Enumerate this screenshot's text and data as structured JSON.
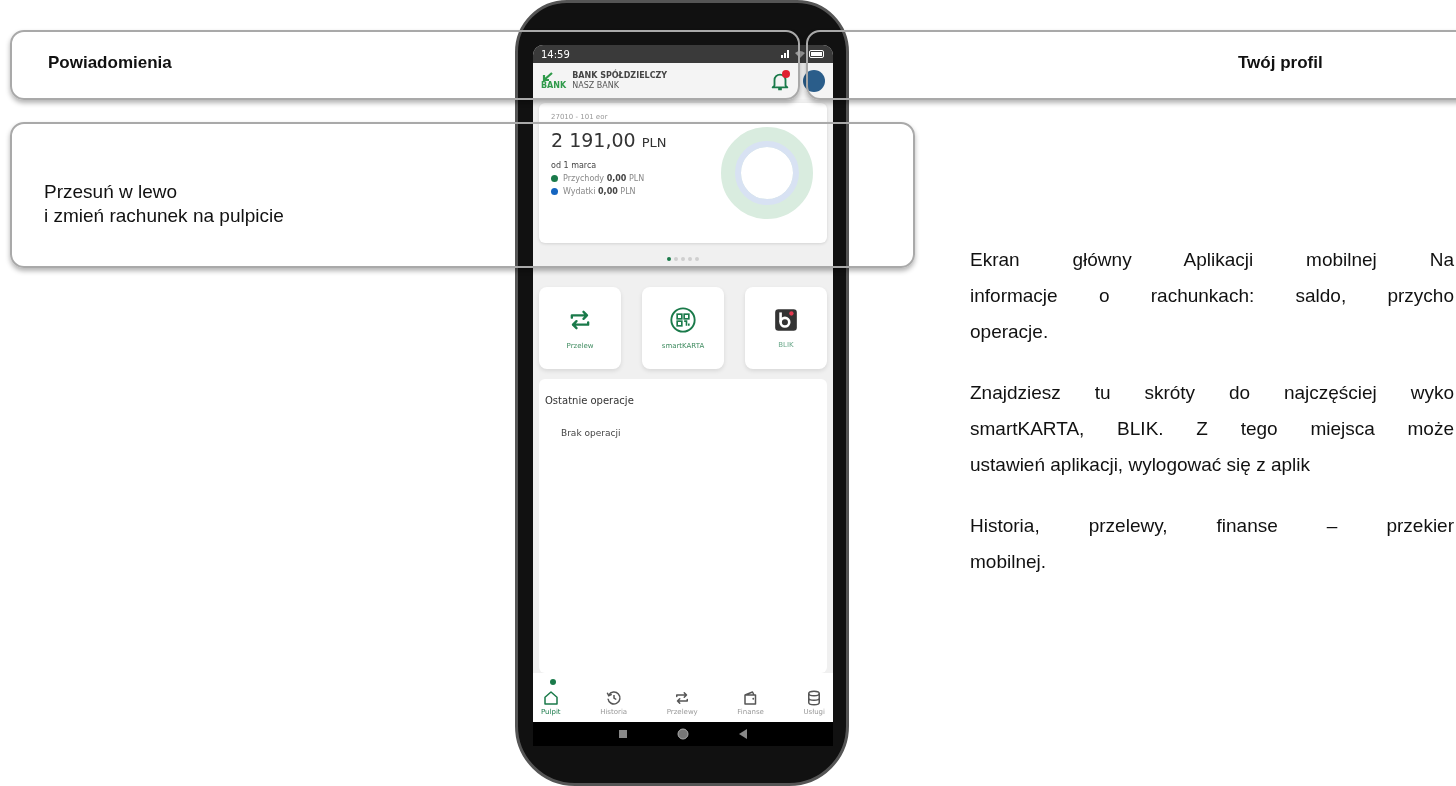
{
  "notifications_callout": {
    "title": "Powiadomienia"
  },
  "profile_callout": {
    "title": "Twój profil"
  },
  "swipe_callout": {
    "lines": [
      "Przesuń w lewo",
      "i zmień rachunek na pulpicie"
    ]
  },
  "description": [
    {
      "lines": [
        "Ekran główny Aplikacji mobilnej Na",
        "informacje o rachunkach: saldo, przycho",
        "operacje."
      ]
    },
    {
      "lines": [
        "Znajdziesz tu skróty do najczęściej wyko",
        "smartKARTA, BLIK. Z tego miejsca może",
        "ustawień aplikacji, wylogować się z aplik"
      ]
    },
    {
      "lines": [
        "Historia, przelewy, finanse – przekier",
        "mobilnej."
      ]
    }
  ],
  "phone": {
    "status_bar": {
      "time": "14:59"
    },
    "header": {
      "logo_text": "BANK",
      "bank_name": "BANK SPÓŁDZIELCZY",
      "bank_subtitle": "NASZ BANK",
      "has_notification": true
    },
    "account_card": {
      "account": "27010 - 101 eor",
      "balance_amount": "2 191,00",
      "balance_currency": "PLN",
      "period": "od 1 marca",
      "legend": [
        {
          "label": "Przychody",
          "amount": "0,00",
          "currency": "PLN",
          "color": "#1a7a4a"
        },
        {
          "label": "Wydatki",
          "amount": "0,00",
          "currency": "PLN",
          "color": "#1565c0"
        }
      ]
    },
    "pager": [
      {
        "selected": true
      },
      {
        "selected": false
      },
      {
        "selected": false
      },
      {
        "selected": false
      },
      {
        "selected": false
      }
    ],
    "shortcuts": [
      {
        "kind": "transfer",
        "label": "Przelew"
      },
      {
        "kind": "qr",
        "label": "smartKARTA"
      },
      {
        "kind": "blik",
        "label": "BLIK"
      }
    ],
    "recent_operations": {
      "title": "Ostatnie operacje",
      "empty_text": "Brak operacji"
    },
    "bottom_nav": [
      {
        "kind": "home",
        "label": "Pulpit",
        "selected": true
      },
      {
        "kind": "history",
        "label": "Historia",
        "selected": false
      },
      {
        "kind": "transfer",
        "label": "Przelewy",
        "selected": false
      },
      {
        "kind": "wallet",
        "label": "Finanse",
        "selected": false
      },
      {
        "kind": "database",
        "label": "Usługi",
        "selected": false
      }
    ]
  }
}
